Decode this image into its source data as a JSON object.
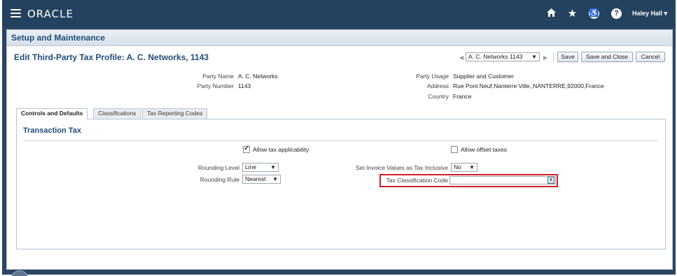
{
  "header": {
    "logo": "ORACLE",
    "icons": [
      "home-icon",
      "star-icon",
      "accessibility-icon",
      "help-icon"
    ],
    "user_name": "Haley Hall",
    "user_caret": "▾"
  },
  "setup": {
    "title": "Setup and Maintenance"
  },
  "page": {
    "title": "Edit Third-Party Tax Profile: A. C. Networks, 1143",
    "record_selector": "A. C. Networks 1143",
    "buttons": {
      "save": "Save",
      "save_close": "Save and Close",
      "cancel": "Cancel"
    }
  },
  "party": {
    "name_label": "Party Name",
    "name_value": "A. C. Networks",
    "number_label": "Party Number",
    "number_value": "1143",
    "usage_label": "Party Usage",
    "usage_value": "Supplier and Customer",
    "address_label": "Address",
    "address_value": "Rue Pont Neuf,Nanterre Ville,,NANTERRE,92000,France",
    "country_label": "Country",
    "country_value": "France"
  },
  "tabs": [
    {
      "label": "Controls and Defaults",
      "active": true
    },
    {
      "label": "Classifications",
      "active": false
    },
    {
      "label": "Tax Reporting Codes",
      "active": false
    }
  ],
  "transaction_tax": {
    "title": "Transaction Tax",
    "allow_tax_applicability": {
      "label": "Allow tax applicability",
      "checked": true
    },
    "allow_offset_taxes": {
      "label": "Allow offset taxes",
      "checked": false
    },
    "rounding_level": {
      "label": "Rounding Level",
      "value": "Line"
    },
    "rounding_rule": {
      "label": "Rounding Rule",
      "value": "Nearest"
    },
    "set_invoice_values": {
      "label": "Set Invoice Values as Tax Inclusive",
      "value": "No"
    },
    "tax_classification_code": {
      "label": "Tax Classification Code",
      "value": ""
    }
  },
  "colors": {
    "header_bg": "#24425f",
    "title_blue": "#1f4b78",
    "highlight_red": "#d0202a"
  }
}
